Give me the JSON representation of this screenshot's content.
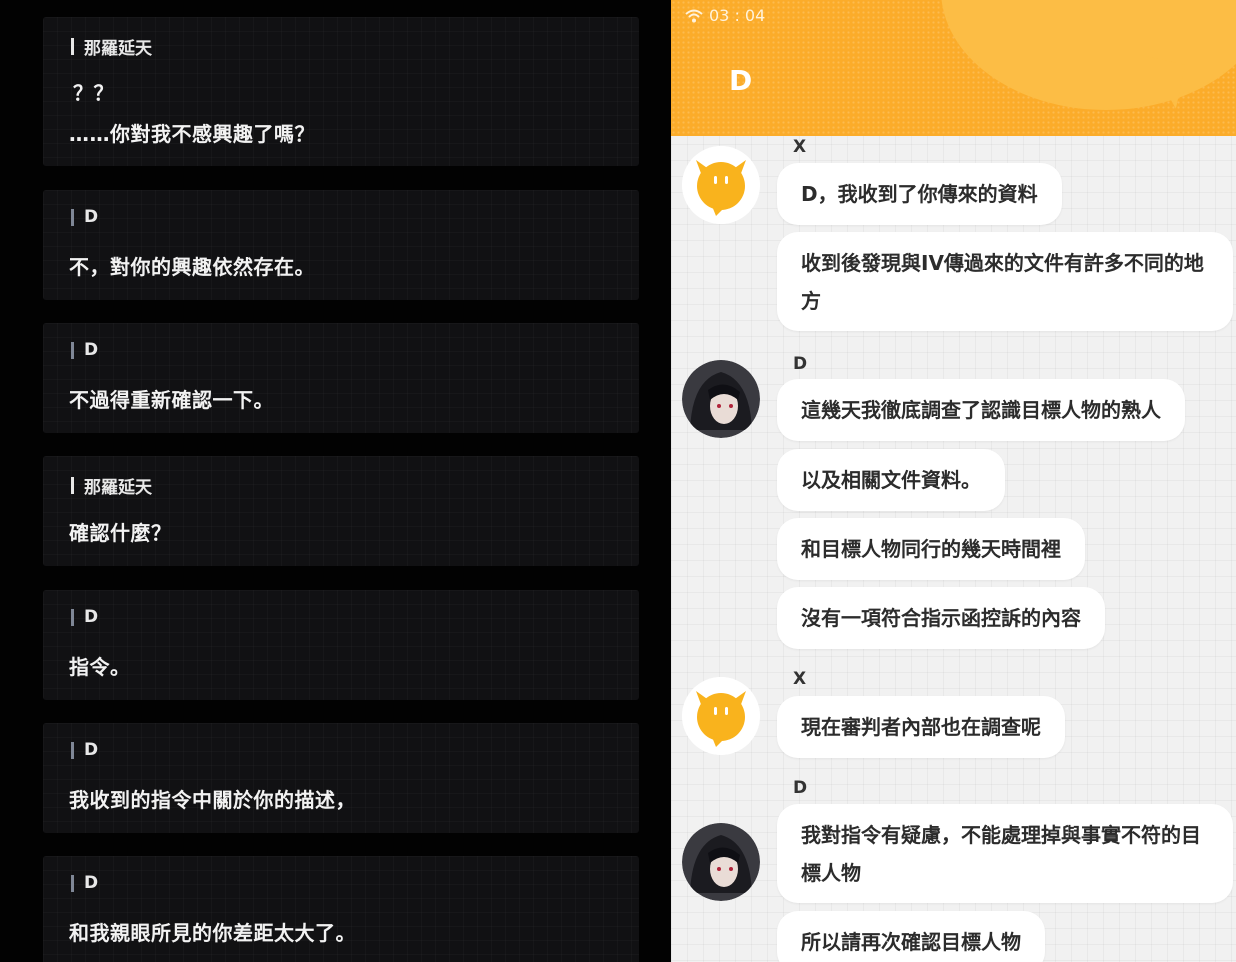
{
  "log": {
    "entries": [
      {
        "speaker": "那羅延天",
        "lines": [
          "？？",
          "……你對我不感興趣了嗎？"
        ]
      },
      {
        "speaker": "D",
        "lines": [
          "不，對你的興趣依然存在。"
        ]
      },
      {
        "speaker": "D",
        "lines": [
          "不過得重新確認一下。"
        ]
      },
      {
        "speaker": "那羅延天",
        "lines": [
          "確認什麼？"
        ]
      },
      {
        "speaker": "D",
        "lines": [
          "指令。"
        ]
      },
      {
        "speaker": "D",
        "lines": [
          "我收到的指令中關於你的描述，"
        ]
      },
      {
        "speaker": "D",
        "lines": [
          "和我親眼所見的你差距太大了。"
        ]
      }
    ]
  },
  "chat": {
    "status_time": "03 : 04",
    "title": "D",
    "groups": [
      {
        "sender": "X",
        "messages": [
          "D，我收到了你傳來的資料",
          "收到後發現與IV傳過來的文件有許多不同的地方"
        ]
      },
      {
        "sender": "D",
        "messages": [
          "這幾天我徹底調查了認識目標人物的熟人",
          "以及相關文件資料。",
          "和目標人物同行的幾天時間裡",
          "沒有一項符合指示函控訴的內容"
        ]
      },
      {
        "sender": "X",
        "messages": [
          "現在審判者內部也在調查呢"
        ]
      },
      {
        "sender": "D",
        "messages": [
          "我對指令有疑慮，不能處理掉與事實不符的目標人物",
          "所以請再次確認目標人物"
        ]
      }
    ],
    "colors": {
      "header": "#fbac2a",
      "background": "#f1f1f1",
      "bubble": "#ffffff",
      "x_avatar": "#f9b31d"
    },
    "icons": [
      "wifi-icon",
      "x-avatar",
      "d-avatar"
    ]
  }
}
